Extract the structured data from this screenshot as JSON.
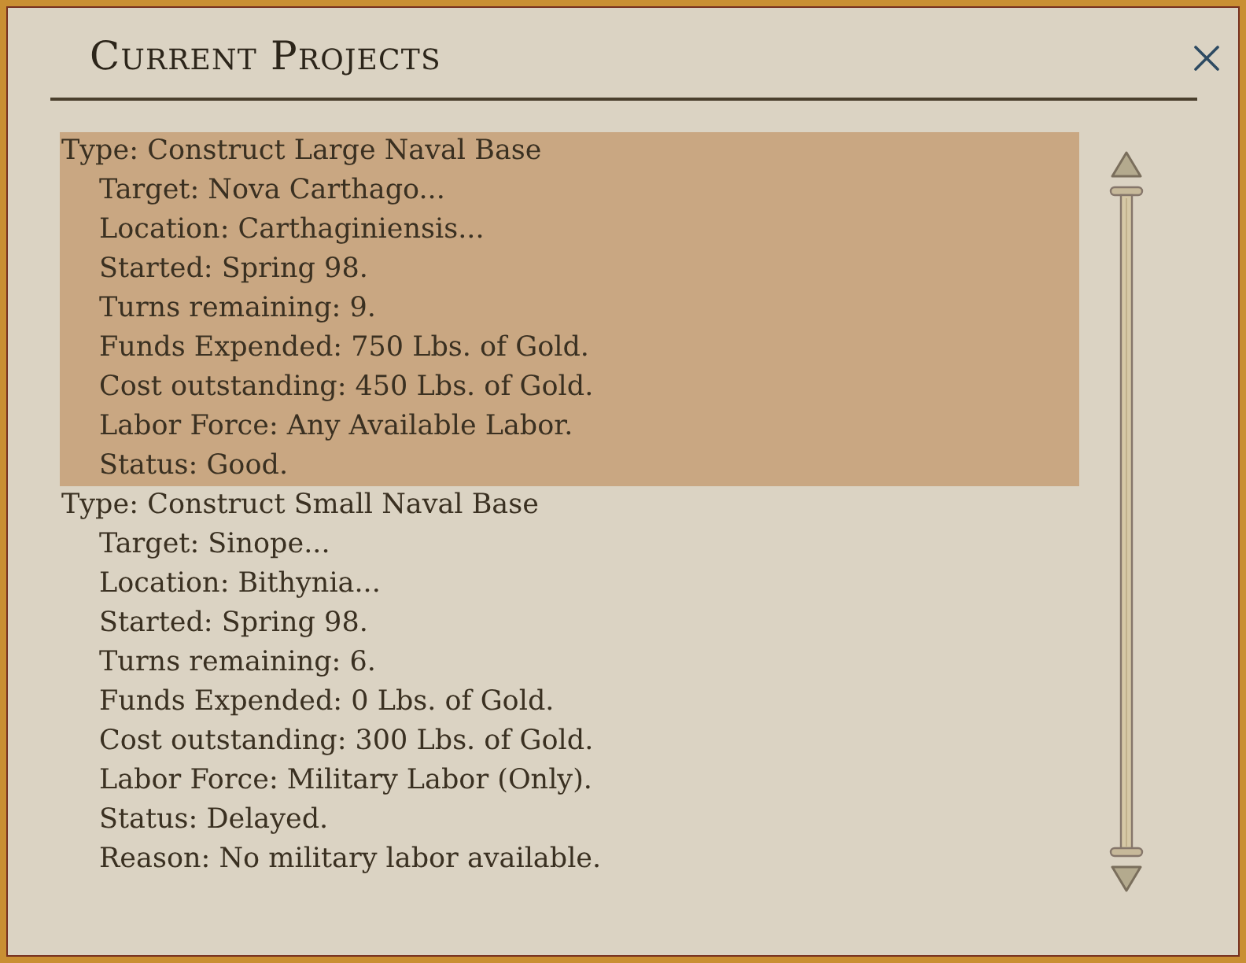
{
  "window": {
    "title": "Current Projects"
  },
  "projects": [
    {
      "selected": true,
      "type": "Type: Construct Large Naval Base",
      "details": [
        "Target: Nova Carthago...",
        "Location: Carthaginiensis...",
        "Started: Spring 98.",
        "Turns remaining: 9.",
        "Funds Expended: 750 Lbs. of Gold.",
        "Cost outstanding: 450 Lbs. of Gold.",
        "Labor Force: Any Available Labor.",
        "Status: Good."
      ]
    },
    {
      "selected": false,
      "type": "Type: Construct Small Naval Base",
      "details": [
        "Target: Sinope...",
        "Location: Bithynia...",
        "Started: Spring 98.",
        "Turns remaining: 6.",
        "Funds Expended: 0 Lbs. of Gold.",
        "Cost outstanding: 300 Lbs. of Gold.",
        "Labor Force: Military Labor (Only).",
        "Status: Delayed.",
        "Reason: No military labor available."
      ]
    }
  ]
}
